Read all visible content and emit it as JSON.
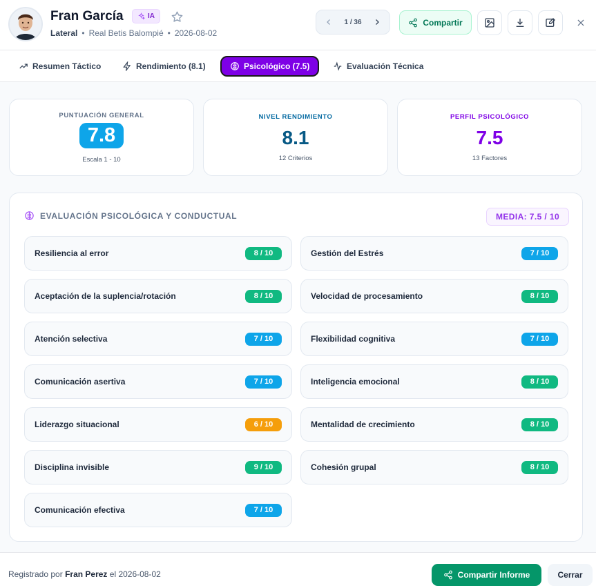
{
  "player": {
    "name": "Fran García",
    "ai_badge": "IA",
    "position": "Lateral",
    "team": "Real Betis Balompié",
    "date": "2026-08-02"
  },
  "pager": {
    "label": "1 / 36"
  },
  "actions": {
    "share_label": "Compartir"
  },
  "tabs": [
    {
      "label": "Resumen Táctico",
      "icon": "trending-up-icon"
    },
    {
      "label": "Rendimiento (8.1)",
      "icon": "zap-icon"
    },
    {
      "label": "Psicológico (7.5)",
      "icon": "brain-icon"
    },
    {
      "label": "Evaluación Técnica",
      "icon": "activity-icon"
    }
  ],
  "summary": {
    "general": {
      "label": "PUNTUACIÓN GENERAL",
      "value": "7.8",
      "sub": "Escala 1 - 10"
    },
    "performance": {
      "label": "NIVEL RENDIMIENTO",
      "value": "8.1",
      "sub": "12 Criterios"
    },
    "psych": {
      "label": "PERFIL PSICOLÓGICO",
      "value": "7.5",
      "sub": "13 Factores"
    }
  },
  "panel": {
    "title": "EVALUACIÓN PSICOLÓGICA Y CONDUCTUAL",
    "average": "MEDIA: 7.5 / 10",
    "items": [
      {
        "name": "Resiliencia al error",
        "score": "8 / 10",
        "level": "green"
      },
      {
        "name": "Gestión del Estrés",
        "score": "7 / 10",
        "level": "blue"
      },
      {
        "name": "Aceptación de la suplencia/rotación",
        "score": "8 / 10",
        "level": "green"
      },
      {
        "name": "Velocidad de procesamiento",
        "score": "8 / 10",
        "level": "green"
      },
      {
        "name": "Atención selectiva",
        "score": "7 / 10",
        "level": "blue"
      },
      {
        "name": "Flexibilidad cognitiva",
        "score": "7 / 10",
        "level": "blue"
      },
      {
        "name": "Comunicación asertiva",
        "score": "7 / 10",
        "level": "blue"
      },
      {
        "name": "Inteligencia emocional",
        "score": "8 / 10",
        "level": "green"
      },
      {
        "name": "Liderazgo situacional",
        "score": "6 / 10",
        "level": "orange"
      },
      {
        "name": "Mentalidad de crecimiento",
        "score": "8 / 10",
        "level": "green"
      },
      {
        "name": "Disciplina invisible",
        "score": "9 / 10",
        "level": "green"
      },
      {
        "name": "Cohesión grupal",
        "score": "8 / 10",
        "level": "green"
      },
      {
        "name": "Comunicación efectiva",
        "score": "7 / 10",
        "level": "blue"
      }
    ]
  },
  "footer": {
    "registered_prefix": "Registrado por",
    "author": "Fran Perez",
    "registered_suffix": "el 2026-08-02",
    "share_report_label": "Compartir Informe",
    "close_label": "Cerrar"
  },
  "colors": {
    "green": "#10b981",
    "blue": "#0ea5e9",
    "orange": "#f59e0b",
    "accent_purple": "#7e00e6",
    "performance_value": "#075985",
    "psych_value": "#7e00e6"
  }
}
